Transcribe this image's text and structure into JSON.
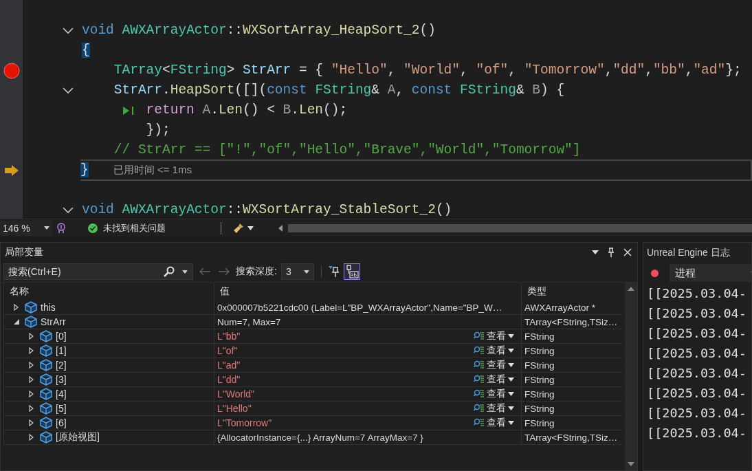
{
  "editor": {
    "lines": [
      {
        "kind": "plain",
        "fold": true,
        "tokens": [
          {
            "kind": "keyword",
            "text": "void "
          },
          {
            "kind": "type",
            "text": "AWXArrayActor"
          },
          {
            "kind": "plain",
            "text": "::"
          },
          {
            "kind": "function",
            "text": "WXSortArray_HeapSort_2"
          },
          {
            "kind": "plain",
            "text": "()"
          }
        ]
      },
      {
        "kind": "plain",
        "fold": false,
        "tokens": [
          {
            "kind": "brace",
            "text": "{"
          }
        ]
      },
      {
        "kind": "breakpoint",
        "fold": false,
        "tokens": [
          {
            "kind": "type",
            "text": "    TArray"
          },
          {
            "kind": "plain",
            "text": "<"
          },
          {
            "kind": "type",
            "text": "FString"
          },
          {
            "kind": "plain",
            "text": "> "
          },
          {
            "kind": "variable",
            "text": "StrArr"
          },
          {
            "kind": "plain",
            "text": " = { "
          },
          {
            "kind": "string",
            "text": "\"Hello\""
          },
          {
            "kind": "plain",
            "text": ", "
          },
          {
            "kind": "string",
            "text": "\"World\""
          },
          {
            "kind": "plain",
            "text": ", "
          },
          {
            "kind": "string",
            "text": "\"of\""
          },
          {
            "kind": "plain",
            "text": ", "
          },
          {
            "kind": "string",
            "text": "\"Tomorrow\""
          },
          {
            "kind": "plain",
            "text": ","
          },
          {
            "kind": "string",
            "text": "\"dd\""
          },
          {
            "kind": "plain",
            "text": ","
          },
          {
            "kind": "string",
            "text": "\"bb\""
          },
          {
            "kind": "plain",
            "text": ","
          },
          {
            "kind": "string",
            "text": "\"ad\""
          },
          {
            "kind": "plain",
            "text": "};"
          }
        ]
      },
      {
        "kind": "plain",
        "fold": true,
        "tokens": [
          {
            "kind": "variable",
            "text": "    StrArr"
          },
          {
            "kind": "plain",
            "text": "."
          },
          {
            "kind": "function",
            "text": "HeapSort"
          },
          {
            "kind": "plain",
            "text": "([]("
          },
          {
            "kind": "keyword",
            "text": "const "
          },
          {
            "kind": "type",
            "text": "FString"
          },
          {
            "kind": "plain",
            "text": "& "
          },
          {
            "kind": "parameter",
            "text": "A"
          },
          {
            "kind": "plain",
            "text": ", "
          },
          {
            "kind": "keyword",
            "text": "const "
          },
          {
            "kind": "type",
            "text": "FString"
          },
          {
            "kind": "plain",
            "text": "& "
          },
          {
            "kind": "parameter",
            "text": "B"
          },
          {
            "kind": "plain",
            "text": ") {"
          }
        ]
      },
      {
        "kind": "plain",
        "fold": false,
        "run_to": true,
        "tokens": [
          {
            "kind": "control",
            "text": "        return "
          },
          {
            "kind": "parameter",
            "text": "A"
          },
          {
            "kind": "plain",
            "text": "."
          },
          {
            "kind": "function",
            "text": "Len"
          },
          {
            "kind": "plain",
            "text": "() < "
          },
          {
            "kind": "parameter",
            "text": "B"
          },
          {
            "kind": "plain",
            "text": "."
          },
          {
            "kind": "function",
            "text": "Len"
          },
          {
            "kind": "plain",
            "text": "();"
          }
        ]
      },
      {
        "kind": "plain",
        "fold": false,
        "tokens": [
          {
            "kind": "plain",
            "text": "        });"
          }
        ]
      },
      {
        "kind": "plain",
        "fold": false,
        "tokens": [
          {
            "kind": "comment",
            "text": "    // StrArr == [\"!\",\"of\",\"Hello\",\"Brave\",\"World\",\"Tomorrow\"]"
          }
        ]
      },
      {
        "kind": "current",
        "fold": false,
        "tokens": [
          {
            "kind": "brace",
            "text": "}"
          }
        ],
        "note": "已用时间 <= 1ms"
      },
      {
        "kind": "plain",
        "fold": false
      },
      {
        "kind": "plain",
        "fold": true,
        "tokens": [
          {
            "kind": "keyword",
            "text": "void "
          },
          {
            "kind": "type",
            "text": "AWXArrayActor"
          },
          {
            "kind": "plain",
            "text": "::"
          },
          {
            "kind": "function",
            "text": "WXSortArray_StableSort_2"
          },
          {
            "kind": "plain",
            "text": "()"
          }
        ]
      }
    ]
  },
  "editor_status": {
    "zoom": "146 %",
    "issues": "未找到相关问题"
  },
  "locals": {
    "title": "局部变量",
    "search": {
      "placeholder": "搜索(Ctrl+E)"
    },
    "depth_label": "搜索深度:",
    "depth": "3",
    "string_format_selected": true,
    "columns": [
      "名称",
      "值",
      "类型"
    ],
    "rows": [
      {
        "name": "this",
        "value": "0x000007b5221cdc00 (Label=L\"BP_WXArrayActor\",Name=\"BP_W…",
        "type": "AWXArrayActor *",
        "kind": "object",
        "expanded": false
      },
      {
        "name": "StrArr",
        "value": "Num=7, Max=7",
        "type": "TArray<FString,TSiz…",
        "kind": "object",
        "expanded": true,
        "children": [
          {
            "name": "[0]",
            "value": "L\"bb\"",
            "type": "FString",
            "kind": "string",
            "viewer": "查看",
            "expanded": false
          },
          {
            "name": "[1]",
            "value": "L\"of\"",
            "type": "FString",
            "kind": "string",
            "viewer": "查看",
            "expanded": false
          },
          {
            "name": "[2]",
            "value": "L\"ad\"",
            "type": "FString",
            "kind": "string",
            "viewer": "查看",
            "expanded": false
          },
          {
            "name": "[3]",
            "value": "L\"dd\"",
            "type": "FString",
            "kind": "string",
            "viewer": "查看",
            "expanded": false
          },
          {
            "name": "[4]",
            "value": "L\"World\"",
            "type": "FString",
            "kind": "string",
            "viewer": "查看",
            "expanded": false
          },
          {
            "name": "[5]",
            "value": "L\"Hello\"",
            "type": "FString",
            "kind": "string",
            "viewer": "查看",
            "expanded": false
          },
          {
            "name": "[6]",
            "value": "L\"Tomorrow\"",
            "type": "FString",
            "kind": "string",
            "viewer": "查看",
            "expanded": false
          },
          {
            "name": "[原始视图]",
            "value": "{AllocatorInstance={...} ArrayNum=7 ArrayMax=7 }",
            "type": "TArray<FString,TSiz…",
            "kind": "object",
            "expanded": false
          }
        ]
      }
    ]
  },
  "log": {
    "title": "Unreal Engine 日志",
    "recording": true,
    "filter": "进程",
    "lines": [
      "[[2025.03.04-",
      "[[2025.03.04-",
      "[[2025.03.04-",
      "[[2025.03.04-",
      "[[2025.03.04-",
      "[[2025.03.04-",
      "[[2025.03.04-",
      "[[2025.03.04-"
    ]
  }
}
